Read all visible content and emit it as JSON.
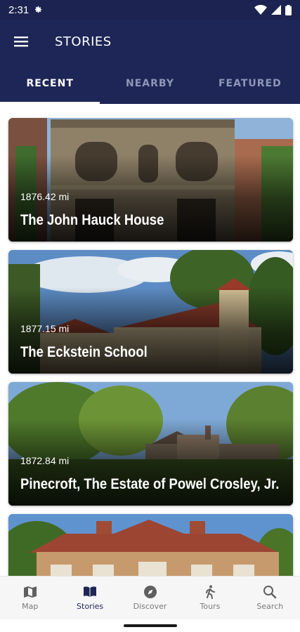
{
  "status_bar": {
    "time": "2:31",
    "icons": [
      "gear-icon",
      "wifi-icon",
      "signal-icon",
      "battery-icon"
    ]
  },
  "app_bar": {
    "title": "STORIES",
    "menu_icon": "hamburger-menu-icon"
  },
  "tabs": [
    {
      "label": "RECENT",
      "active": true
    },
    {
      "label": "NEARBY",
      "active": false
    },
    {
      "label": "FEATURED",
      "active": false
    }
  ],
  "stories": [
    {
      "distance": "1876.42 mi",
      "title": "The John Hauck House"
    },
    {
      "distance": "1877.15 mi",
      "title": "The Eckstein School"
    },
    {
      "distance": "1872.84 mi",
      "title": "Pinecroft, The Estate of Powel Crosley, Jr."
    },
    {
      "distance": "",
      "title": ""
    }
  ],
  "bottom_nav": [
    {
      "label": "Map",
      "icon": "map-icon",
      "active": false
    },
    {
      "label": "Stories",
      "icon": "book-icon",
      "active": true
    },
    {
      "label": "Discover",
      "icon": "compass-icon",
      "active": false
    },
    {
      "label": "Tours",
      "icon": "walking-person-icon",
      "active": false
    },
    {
      "label": "Search",
      "icon": "search-icon",
      "active": false
    }
  ],
  "colors": {
    "primary": "#1e2657",
    "status_bar": "#1c2350",
    "active_nav": "#1e2657",
    "inactive": "#7a7a7a"
  }
}
